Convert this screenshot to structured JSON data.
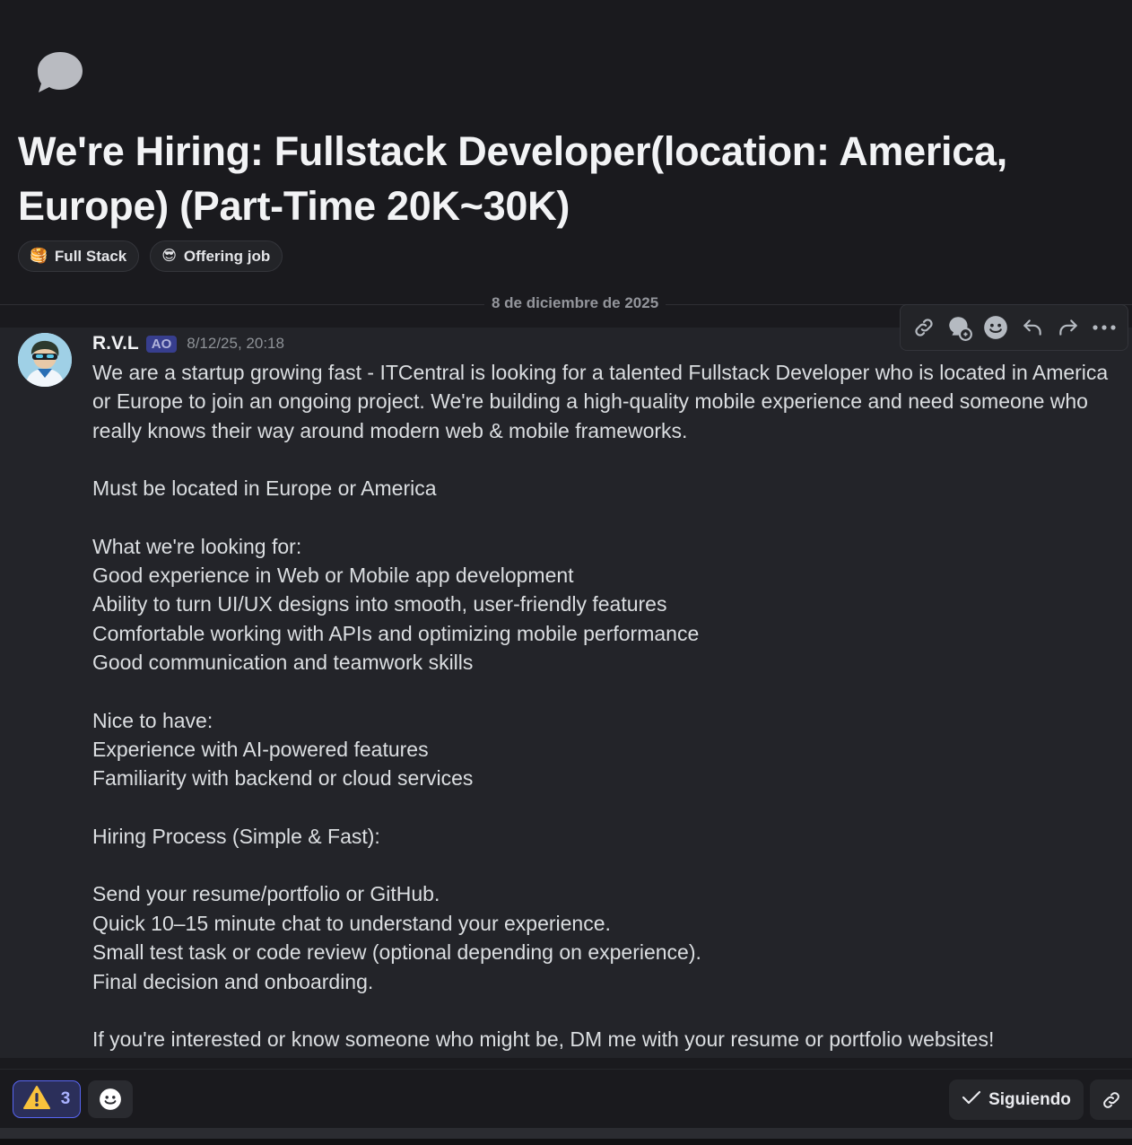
{
  "thread": {
    "title": "We're Hiring: Fullstack Developer(location: America, Europe) (Part-Time 20K~30K)",
    "tags": [
      {
        "emoji": "🥞",
        "label": "Full Stack"
      },
      {
        "emoji": "😎",
        "label": "Offering job"
      }
    ],
    "date_divider": "8 de diciembre de 2025"
  },
  "message": {
    "author": "R.V.L",
    "role_badge": "AO",
    "timestamp": "8/12/25, 20:18",
    "paragraphs": [
      "We are a startup growing fast - ITCentral is looking for a talented Fullstack Developer who is located in America or Europe to join an ongoing project. We're building a high-quality mobile experience and need someone who really knows their way around modern web & mobile frameworks.",
      "Must be located in Europe or America",
      "What we're looking for:\nGood experience in Web or Mobile app development\nAbility to turn UI/UX designs into smooth, user-friendly features\nComfortable working with APIs and optimizing mobile performance\nGood communication and teamwork skills",
      "Nice to have:\nExperience with AI-powered features\nFamiliarity with backend or cloud services",
      "Hiring Process (Simple & Fast):",
      "Send your resume/portfolio or GitHub.\nQuick 10–15 minute chat to understand your experience.\nSmall test task or code review (optional depending on experience).\nFinal decision and onboarding.",
      "If you're interested or know someone who might be, DM me with your resume or portfolio websites!"
    ]
  },
  "toolbar": {
    "icons": [
      "link-icon",
      "thread-reply-icon",
      "emoji-icon",
      "reply-icon",
      "forward-icon",
      "more-icon"
    ]
  },
  "reactions": [
    {
      "emoji": "⚠️",
      "count": "3"
    }
  ],
  "footer": {
    "follow_label": "Siguiendo"
  },
  "colors": {
    "background": "#1a1a1e",
    "message_bg": "#232429",
    "accent": "#5865f2",
    "text": "#dbdee1"
  }
}
